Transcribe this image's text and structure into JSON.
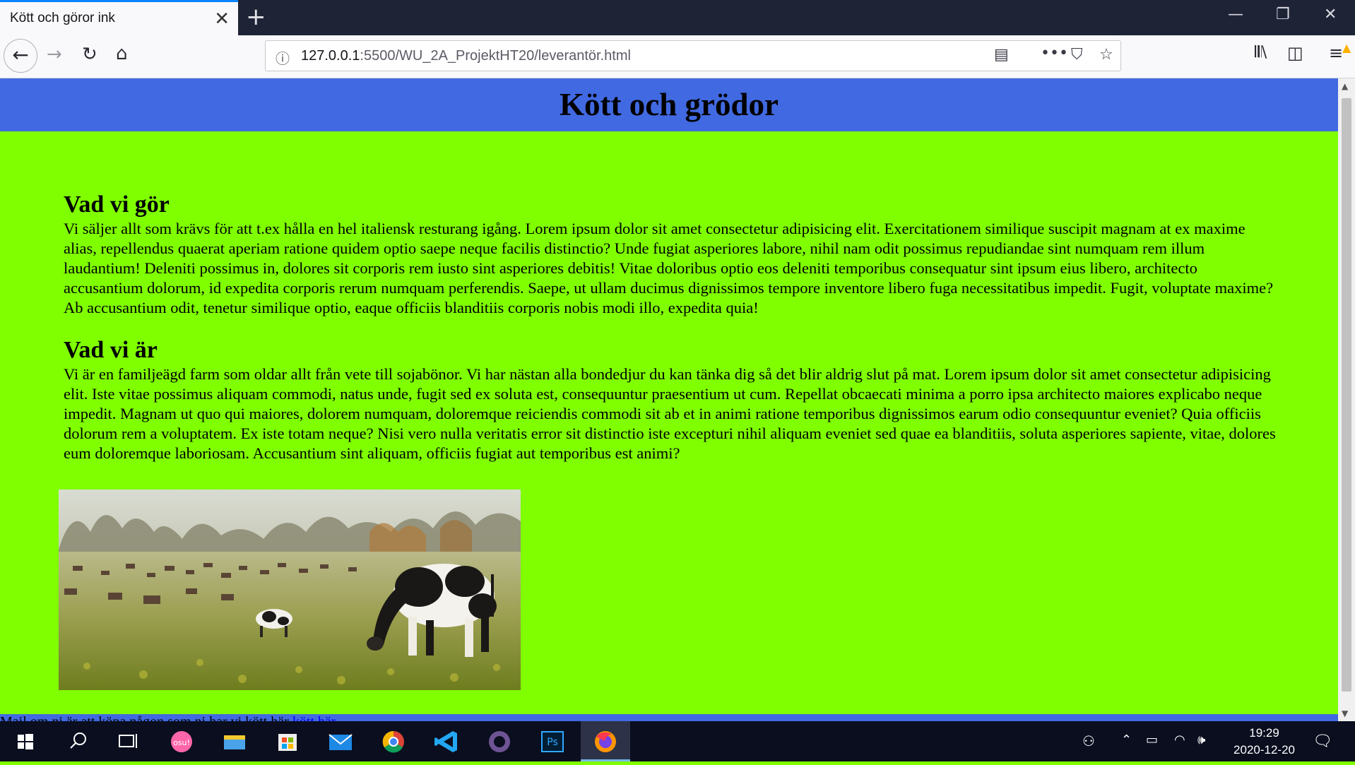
{
  "browser": {
    "tab_title": "Kött och göror ink",
    "url_host": "127.0.0.1",
    "url_path": ":5500/WU_2A_ProjektHT20/leverantör.html"
  },
  "page": {
    "header_title": "Kött och grödor",
    "section1": {
      "heading": "Vad vi gör",
      "body": "Vi säljer allt som krävs för att t.ex hålla en hel italiensk resturang igång. Lorem ipsum dolor sit amet consectetur adipisicing elit. Exercitationem similique suscipit magnam at ex maxime alias, repellendus quaerat aperiam ratione quidem optio saepe neque facilis distinctio? Unde fugiat asperiores labore, nihil nam odit possimus repudiandae sint numquam rem illum laudantium! Deleniti possimus in, dolores sit corporis rem iusto sint asperiores debitis! Vitae doloribus optio eos deleniti temporibus consequatur sint ipsum eius libero, architecto accusantium dolorum, id expedita corporis rerum numquam perferendis. Saepe, ut ullam ducimus dignissimos tempore inventore libero fuga necessitatibus impedit. Fugit, voluptate maxime? Ab accusantium odit, tenetur similique optio, eaque officiis blanditiis corporis nobis modi illo, expedita quia!"
    },
    "section2": {
      "heading": "Vad vi är",
      "body": "Vi är en familjeägd farm som oldar allt från vete till sojabönor. Vi har nästan alla bondedjur du kan tänka dig så det blir aldrig slut på mat. Lorem ipsum dolor sit amet consectetur adipisicing elit. Iste vitae possimus aliquam commodi, natus unde, fugit sed ex soluta est, consequuntur praesentium ut cum. Repellat obcaecati minima a porro ipsa architecto maiores explicabo neque impedit. Magnam ut quo qui maiores, dolorem numquam, doloremque reiciendis commodi sit ab et in animi ratione temporibus dignissimos earum odio consequuntur eveniet? Quia officiis dolorum rem a voluptatem. Ex iste totam neque? Nisi vero nulla veritatis error sit distinctio iste excepturi nihil aliquam eveniet sed quae ea blanditiis, soluta asperiores sapiente, vitae, dolores eum doloremque laboriosam. Accusantium sint aliquam, officiis fugiat aut temporibus est animi?"
    },
    "footer_text": "Mail om ni är att köpa någon som ni har vi kött här",
    "footer_link": "kött här",
    "colors": {
      "header_bg": "#4169e1",
      "page_bg": "#7fff00"
    }
  },
  "taskbar": {
    "time": "19:29",
    "date": "2020-12-20",
    "apps": [
      "windows-start",
      "search",
      "task-view",
      "osu",
      "file-explorer",
      "microsoft-store",
      "mail",
      "chrome",
      "vscode",
      "github-desktop",
      "photoshop",
      "firefox"
    ]
  }
}
